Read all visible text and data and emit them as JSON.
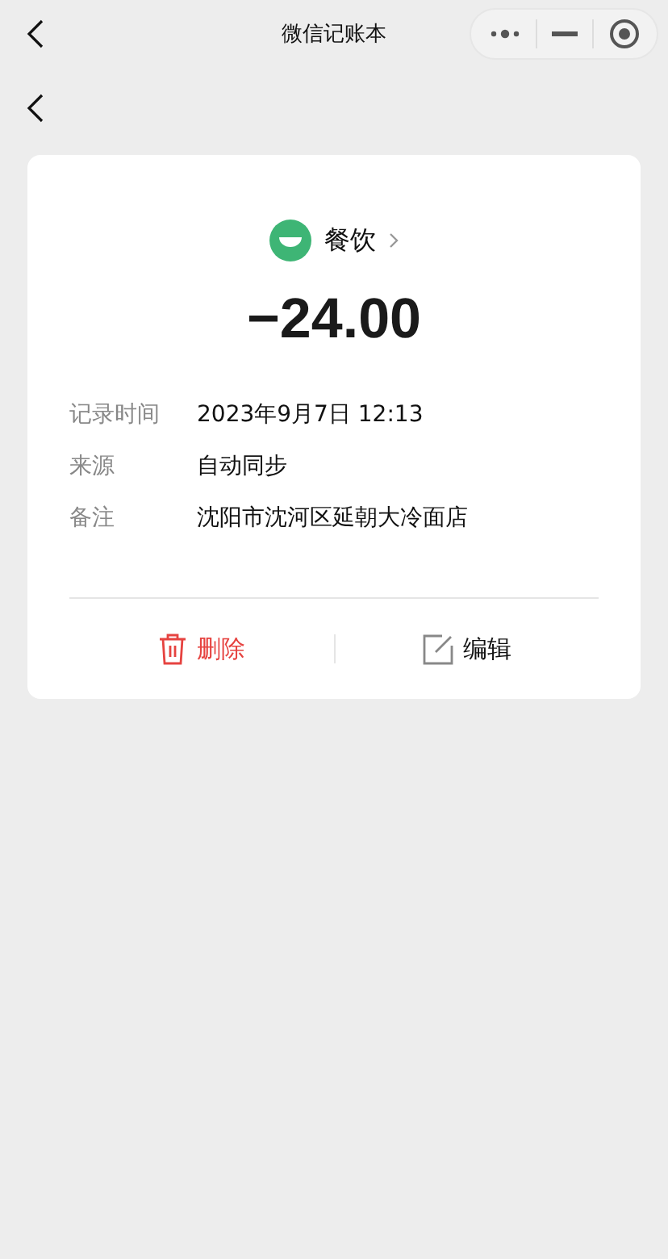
{
  "title_bar": {
    "title": "微信记账本"
  },
  "record": {
    "category": "餐饮",
    "amount": "−24.00",
    "fields": [
      {
        "label": "记录时间",
        "value": "2023年9月7日 12:13"
      },
      {
        "label": "来源",
        "value": "自动同步"
      },
      {
        "label": "备注",
        "value": "沈阳市沈河区延朝大冷面店"
      }
    ]
  },
  "actions": [
    {
      "kind": "delete",
      "label": "删除"
    },
    {
      "kind": "edit",
      "label": "编辑"
    }
  ]
}
